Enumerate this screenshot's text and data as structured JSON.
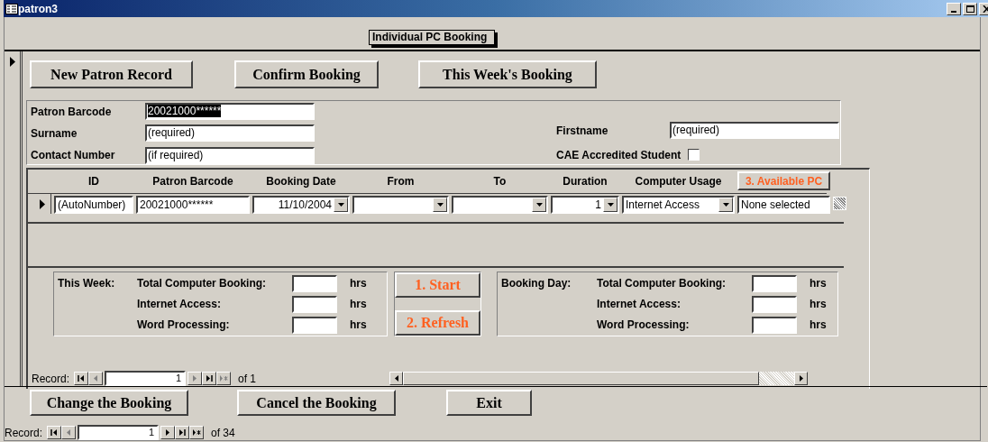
{
  "window": {
    "title": "patron3"
  },
  "form_title": "Individual PC Booking",
  "top_buttons": [
    "New Patron Record",
    "Confirm Booking",
    "This Week's Booking"
  ],
  "patron_fields": [
    {
      "label": "Patron Barcode",
      "value": "20021000******",
      "selected": true
    },
    {
      "label": "Surname",
      "value": "(required)",
      "selected": false
    },
    {
      "label": "Contact Number",
      "value": "(if required)",
      "selected": false
    }
  ],
  "firstname": {
    "label": "Firstname",
    "value": "(required)"
  },
  "cae": {
    "label": "CAE Accredited Student",
    "checked": false
  },
  "bookings": {
    "columns": [
      "ID",
      "Patron Barcode",
      "Booking Date",
      "From",
      "To",
      "Duration",
      "Computer Usage"
    ],
    "available_pc_button": "3. Available PC",
    "row": [
      {
        "kind": "text",
        "value": "(AutoNumber)"
      },
      {
        "kind": "text",
        "value": "20021000******"
      },
      {
        "kind": "combo",
        "value": "11/10/2004"
      },
      {
        "kind": "combo"
      },
      {
        "kind": "combo"
      },
      {
        "kind": "combo",
        "value": "1"
      },
      {
        "kind": "combo",
        "value": "Internet Access"
      },
      {
        "kind": "text",
        "value": "None selected"
      }
    ],
    "summaries": [
      {
        "heading": "This Week:",
        "rows": [
          {
            "label": "Total Computer Booking:",
            "unit": "hrs"
          },
          {
            "label": "Internet Access:",
            "unit": "hrs"
          },
          {
            "label": "Word Processing:",
            "unit": "hrs"
          }
        ]
      },
      {
        "heading": "Booking Day:",
        "rows": [
          {
            "label": "Total Computer Booking:",
            "unit": "hrs"
          },
          {
            "label": "Internet Access:",
            "unit": "hrs"
          },
          {
            "label": "Word Processing:",
            "unit": "hrs"
          }
        ]
      }
    ],
    "action_buttons": [
      "1. Start",
      "2. Refresh"
    ],
    "navigator": {
      "label": "Record:",
      "current": "1",
      "total": "of 1",
      "buttons": [
        {
          "kind": "first",
          "disabled": false
        },
        {
          "kind": "prev",
          "disabled": true
        },
        {
          "kind": "next",
          "disabled": true
        },
        {
          "kind": "last",
          "disabled": false
        },
        {
          "kind": "new",
          "disabled": true
        }
      ]
    }
  },
  "bottom_buttons": [
    "Change the Booking",
    "Cancel the Booking",
    "Exit"
  ],
  "navigator": {
    "label": "Record:",
    "current": "1",
    "total": "of 34",
    "buttons": [
      {
        "kind": "first",
        "disabled": false
      },
      {
        "kind": "prev",
        "disabled": true
      },
      {
        "kind": "next",
        "disabled": false
      },
      {
        "kind": "last",
        "disabled": false
      },
      {
        "kind": "new",
        "disabled": false
      }
    ]
  }
}
